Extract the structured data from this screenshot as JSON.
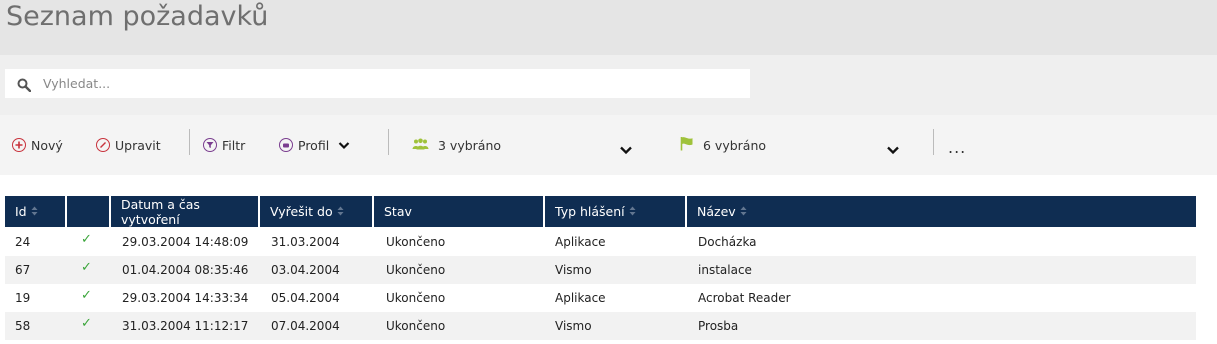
{
  "page": {
    "title": "Seznam požadavků"
  },
  "search": {
    "placeholder": "Vyhledat..."
  },
  "toolbar": {
    "new_label": "Nový",
    "edit_label": "Upravit",
    "filter_label": "Filtr",
    "profile_label": "Profil",
    "group_select": "3 vybráno",
    "flag_select": "6 vybráno",
    "more_label": "..."
  },
  "colors": {
    "header_bg": "#0f2d52",
    "accent_red": "#c8323c",
    "accent_purple": "#7a3d8f",
    "icon_green": "#9fc23a",
    "check_green": "#3aa53a"
  },
  "table": {
    "columns": [
      "Id",
      "",
      "Datum a čas vytvoření",
      "Vyřešit do",
      "Stav",
      "Typ hlášení",
      "Název"
    ],
    "rows": [
      {
        "id": "24",
        "done": true,
        "created": "29.03.2004 14:48:09",
        "due": "31.03.2004",
        "state": "Ukončeno",
        "type": "Aplikace",
        "name": "Docházka"
      },
      {
        "id": "67",
        "done": true,
        "created": "01.04.2004 08:35:46",
        "due": "03.04.2004",
        "state": "Ukončeno",
        "type": "Vismo",
        "name": "instalace"
      },
      {
        "id": "19",
        "done": true,
        "created": "29.03.2004 14:33:34",
        "due": "05.04.2004",
        "state": "Ukončeno",
        "type": "Aplikace",
        "name": "Acrobat Reader"
      },
      {
        "id": "58",
        "done": true,
        "created": "31.03.2004 11:12:17",
        "due": "07.04.2004",
        "state": "Ukončeno",
        "type": "Vismo",
        "name": "Prosba"
      }
    ]
  }
}
